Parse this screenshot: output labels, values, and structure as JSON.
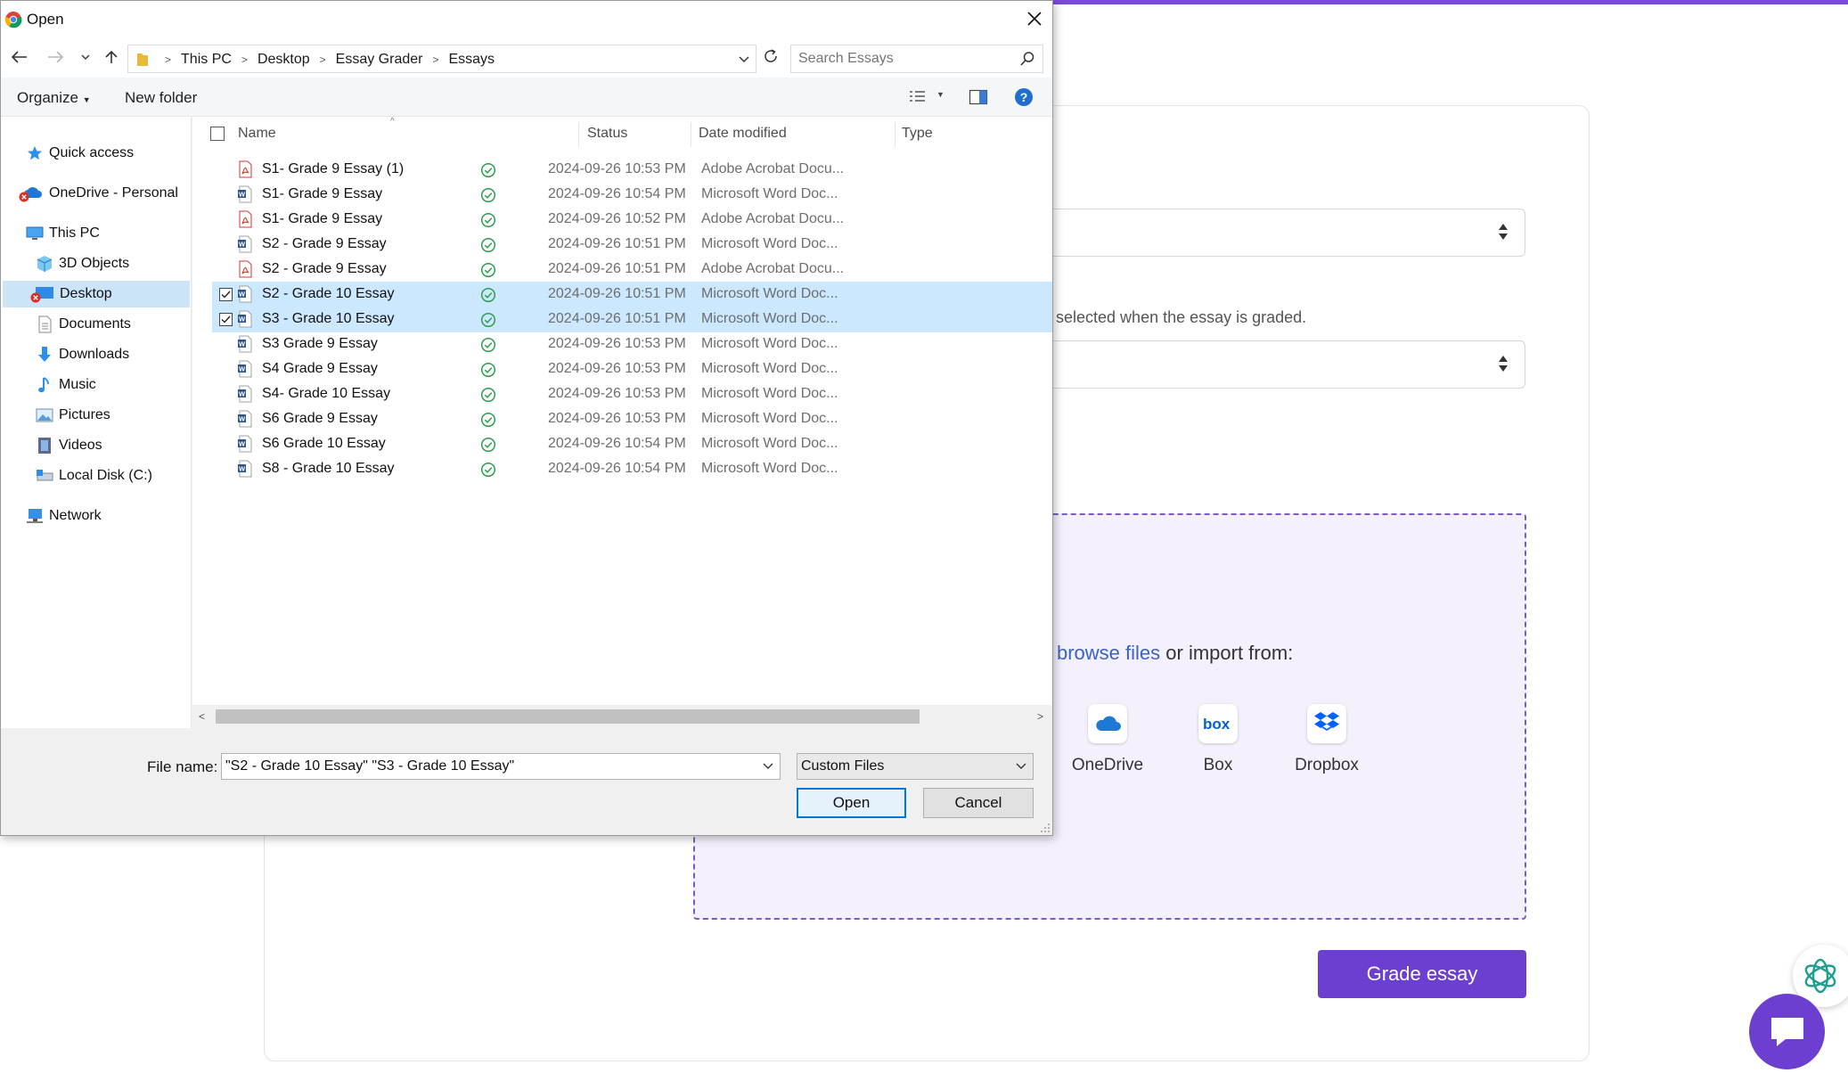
{
  "background_app": {
    "helper_text": "e selected when the essay is graded.",
    "dropzone": {
      "browse_link": "browse files",
      "import_text": " or import from:",
      "sources": [
        {
          "label": "OneDrive",
          "icon": "onedrive-icon"
        },
        {
          "label": "Box",
          "icon": "box-icon"
        },
        {
          "label": "Dropbox",
          "icon": "dropbox-icon"
        }
      ]
    },
    "grade_button": "Grade essay",
    "accent_color": "#6c3fd0"
  },
  "dialog": {
    "title": "Open",
    "breadcrumbs": [
      "This PC",
      "Desktop",
      "Essay Grader",
      "Essays"
    ],
    "search_placeholder": "Search Essays",
    "toolbar": {
      "organize": "Organize",
      "new_folder": "New folder"
    },
    "nav": [
      {
        "label": "Quick access",
        "icon": "star-icon"
      },
      {
        "label": "OneDrive - Personal",
        "icon": "onedrive-icon"
      },
      {
        "label": "This PC",
        "icon": "computer-icon"
      },
      {
        "label": "3D Objects",
        "icon": "cube-icon"
      },
      {
        "label": "Desktop",
        "icon": "desktop-icon",
        "selected": true
      },
      {
        "label": "Documents",
        "icon": "documents-icon"
      },
      {
        "label": "Downloads",
        "icon": "download-icon"
      },
      {
        "label": "Music",
        "icon": "music-icon"
      },
      {
        "label": "Pictures",
        "icon": "pictures-icon"
      },
      {
        "label": "Videos",
        "icon": "videos-icon"
      },
      {
        "label": "Local Disk (C:)",
        "icon": "disk-icon"
      },
      {
        "label": "Network",
        "icon": "network-icon"
      }
    ],
    "columns": {
      "name": "Name",
      "status": "Status",
      "date": "Date modified",
      "type": "Type"
    },
    "files": [
      {
        "name": "S1- Grade 9 Essay (1)",
        "date": "2024-09-26 10:53 PM",
        "type": "Adobe Acrobat Docu...",
        "kind": "pdf",
        "selected": false
      },
      {
        "name": "S1- Grade 9 Essay",
        "date": "2024-09-26 10:54 PM",
        "type": "Microsoft Word Doc...",
        "kind": "word",
        "selected": false
      },
      {
        "name": "S1- Grade 9 Essay",
        "date": "2024-09-26 10:52 PM",
        "type": "Adobe Acrobat Docu...",
        "kind": "pdf",
        "selected": false
      },
      {
        "name": "S2 - Grade 9 Essay",
        "date": "2024-09-26 10:51 PM",
        "type": "Microsoft Word Doc...",
        "kind": "word",
        "selected": false
      },
      {
        "name": "S2 - Grade 9 Essay",
        "date": "2024-09-26 10:51 PM",
        "type": "Adobe Acrobat Docu...",
        "kind": "pdf",
        "selected": false
      },
      {
        "name": "S2 - Grade 10 Essay",
        "date": "2024-09-26 10:51 PM",
        "type": "Microsoft Word Doc...",
        "kind": "word",
        "selected": true
      },
      {
        "name": "S3 - Grade 10 Essay",
        "date": "2024-09-26 10:51 PM",
        "type": "Microsoft Word Doc...",
        "kind": "word",
        "selected": true
      },
      {
        "name": "S3 Grade 9 Essay",
        "date": "2024-09-26 10:53 PM",
        "type": "Microsoft Word Doc...",
        "kind": "word",
        "selected": false
      },
      {
        "name": "S4 Grade 9 Essay",
        "date": "2024-09-26 10:53 PM",
        "type": "Microsoft Word Doc...",
        "kind": "word",
        "selected": false
      },
      {
        "name": "S4- Grade 10 Essay",
        "date": "2024-09-26 10:53 PM",
        "type": "Microsoft Word Doc...",
        "kind": "word",
        "selected": false
      },
      {
        "name": "S6 Grade 9 Essay",
        "date": "2024-09-26 10:53 PM",
        "type": "Microsoft Word Doc...",
        "kind": "word",
        "selected": false
      },
      {
        "name": "S6 Grade 10 Essay",
        "date": "2024-09-26 10:54 PM",
        "type": "Microsoft Word Doc...",
        "kind": "word",
        "selected": false
      },
      {
        "name": "S8 - Grade 10 Essay",
        "date": "2024-09-26 10:54 PM",
        "type": "Microsoft Word Doc...",
        "kind": "word",
        "selected": false
      }
    ],
    "file_name_label": "File name:",
    "file_name_value": "\"S2 - Grade 10 Essay\" \"S3 - Grade 10 Essay\"",
    "filter_value": "Custom Files",
    "open_button": "Open",
    "cancel_button": "Cancel",
    "colors": {
      "selection": "#cce8ff",
      "status_ok": "#2e9e4f",
      "word": "#2b5797",
      "pdf": "#d33a2c"
    }
  }
}
